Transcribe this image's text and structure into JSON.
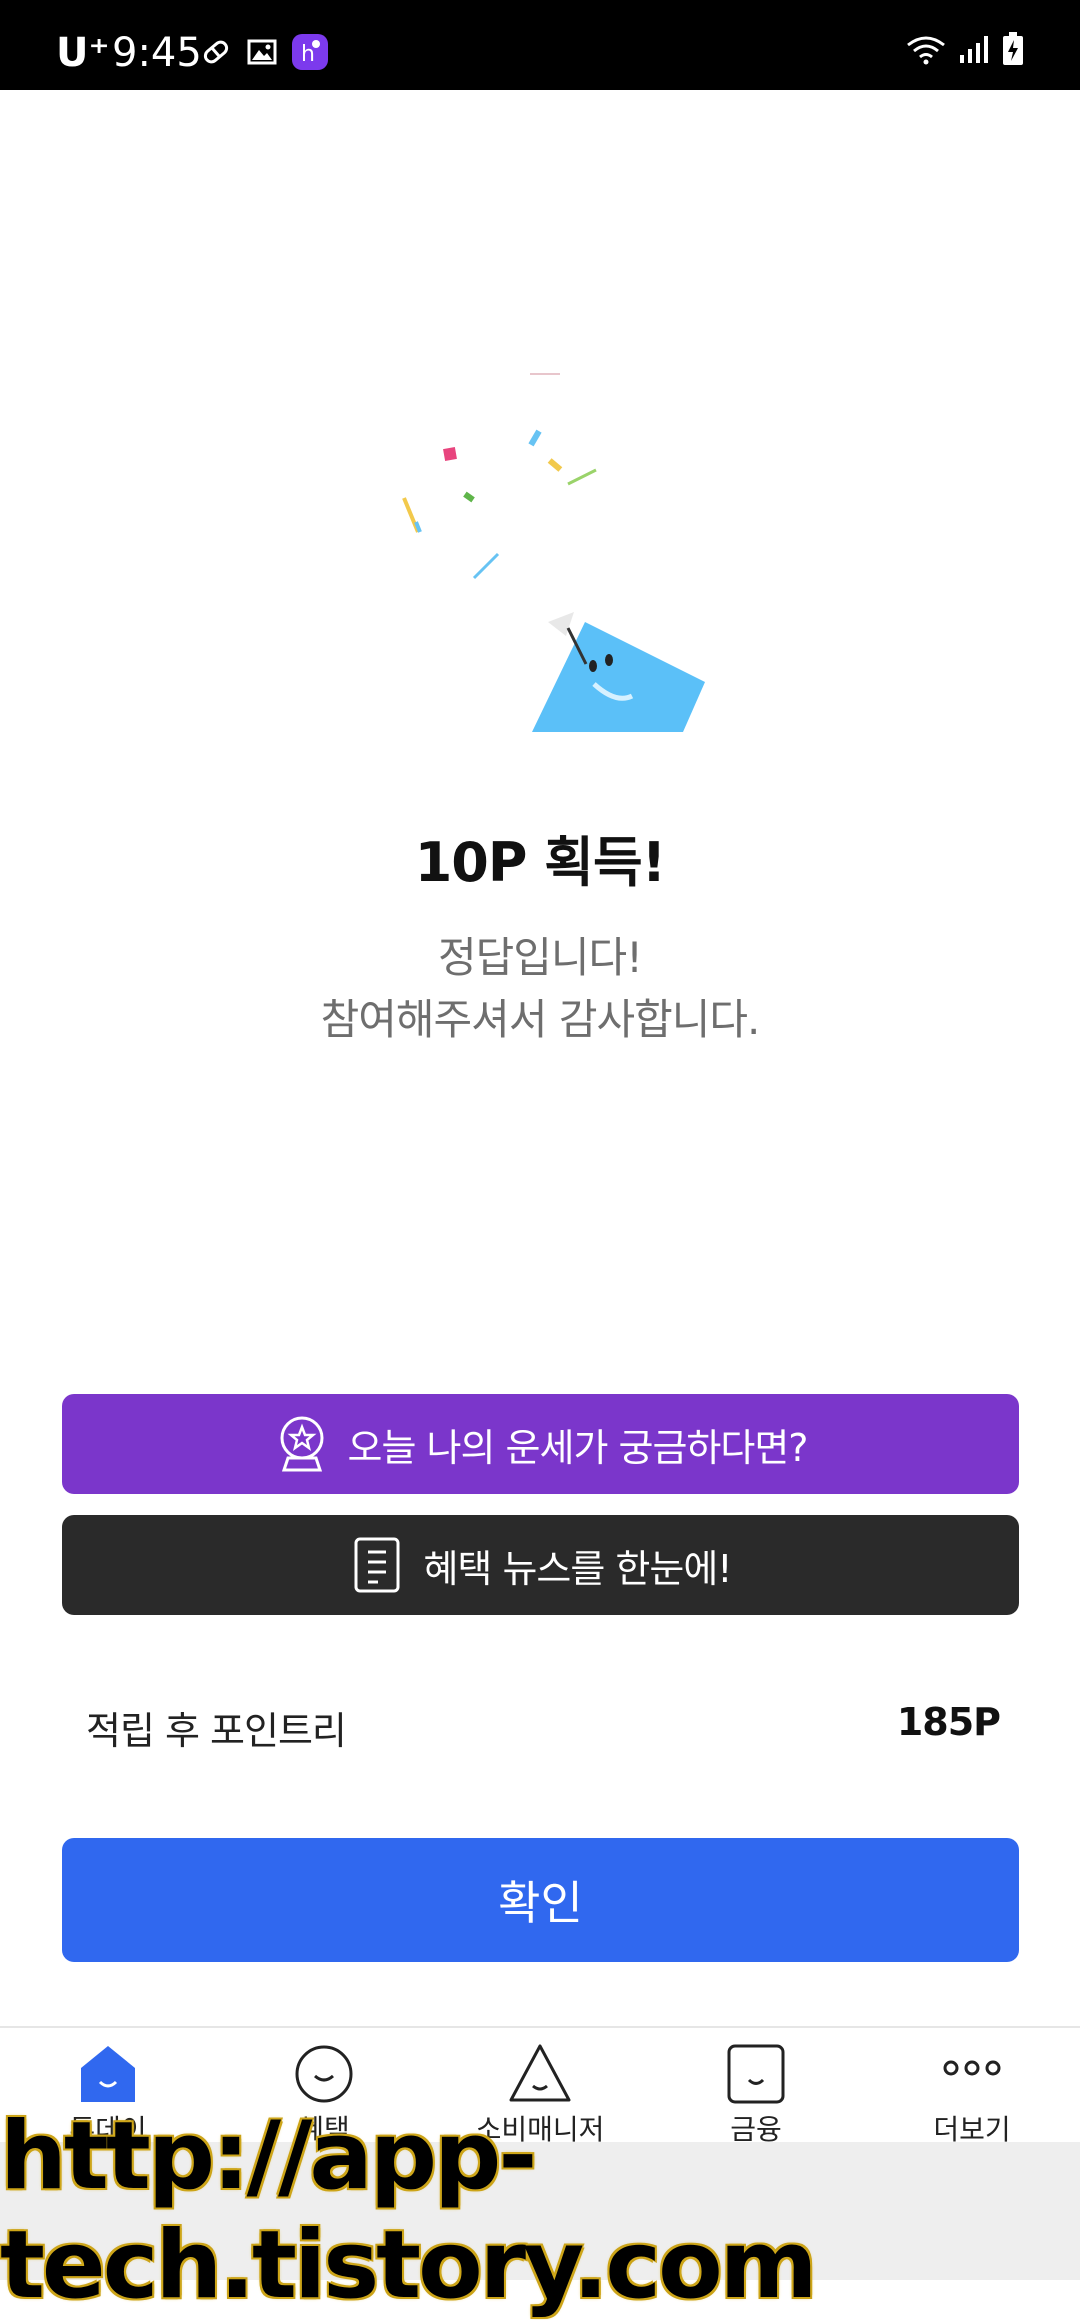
{
  "status_bar": {
    "carrier": "U⁺",
    "time": "9:45"
  },
  "result": {
    "title": "10P 획득!",
    "message_line1": "정답입니다!",
    "message_line2": "참여해주셔서 감사합니다."
  },
  "banners": {
    "fortune_label": "오늘 나의 운세가 궁금하다면?",
    "news_label": "혜택 뉴스를 한눈에!"
  },
  "points": {
    "label": "적립 후 포인트리",
    "value": "185P"
  },
  "confirm_label": "확인",
  "nav": {
    "items": [
      {
        "label": "투데이",
        "icon": "home-icon",
        "active": true
      },
      {
        "label": "혜택",
        "icon": "smile-circle-icon"
      },
      {
        "label": "소비매니저",
        "icon": "triangle-face-icon"
      },
      {
        "label": "금융",
        "icon": "square-face-icon"
      },
      {
        "label": "더보기",
        "icon": "more-dots-icon"
      }
    ]
  },
  "watermark": "http://app-tech.tistory.com",
  "colors": {
    "fortune_banner": "#7b36cb",
    "news_banner": "#2a2a2a",
    "confirm_button": "#3068ef",
    "active_nav": "#3068ef"
  }
}
